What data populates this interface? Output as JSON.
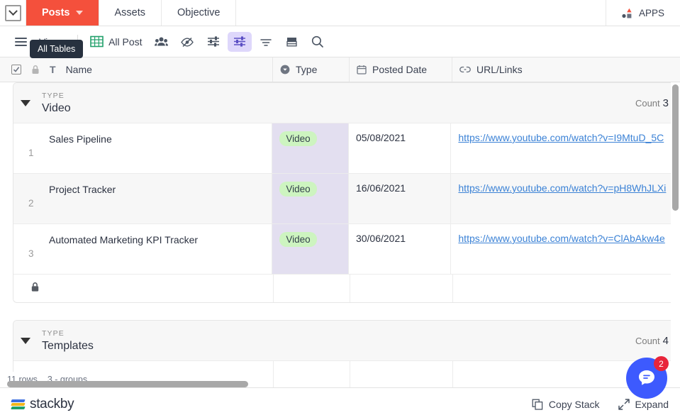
{
  "tabs": {
    "collapse_icon": "chevron-down-icon",
    "items": [
      {
        "label": "Posts",
        "active": true,
        "caret": true
      },
      {
        "label": "Assets",
        "active": false,
        "caret": false
      },
      {
        "label": "Objective",
        "active": false,
        "caret": false
      }
    ],
    "apps_label": "APPS",
    "apps_icon": "apps-icon",
    "active_color": "#f4503c"
  },
  "toolbar": {
    "menu_icon": "hamburger-icon",
    "views_label": "Views",
    "tooltip": "All Tables",
    "grid_icon": "grid-view-icon",
    "view_name": "All Post",
    "collaborators_icon": "collaborators-icon",
    "hide_fields_icon": "hide-fields-icon",
    "filter_icon": "filter-icon",
    "group_icon": "group-icon",
    "sort_icon": "sort-icon",
    "row_height_icon": "row-height-icon",
    "search_icon": "search-icon",
    "selected_accent": "#ded7fb"
  },
  "grid": {
    "columns": [
      {
        "label": "Name",
        "icon": "text-field-icon",
        "lock_icon": "lock-icon",
        "checkbox_icon": "checkbox-checked-icon"
      },
      {
        "label": "Type",
        "icon": "single-select-icon"
      },
      {
        "label": "Posted Date",
        "icon": "calendar-icon"
      },
      {
        "label": "URL/Links",
        "icon": "link-icon"
      }
    ],
    "groups": [
      {
        "field_label": "TYPE",
        "value": "Video",
        "count_label": "Count",
        "count": "3",
        "rows": [
          {
            "num": "1",
            "name": "Sales Pipeline",
            "type": "Video",
            "date": "05/08/2021",
            "url": "https://www.youtube.com/watch?v=I9MtuD_5C"
          },
          {
            "num": "2",
            "name": "Project Tracker",
            "type": "Video",
            "date": "16/06/2021",
            "url": "https://www.youtube.com/watch?v=pH8WhJLXi"
          },
          {
            "num": "3",
            "name": "Automated Marketing KPI Tracker",
            "type": "Video",
            "date": "30/06/2021",
            "url": "https://www.youtube.com/watch?v=ClAbAkw4e"
          }
        ],
        "add_row_icon": "lock-icon"
      },
      {
        "field_label": "TYPE",
        "value": "Templates",
        "count_label": "Count",
        "count": "4",
        "rows": [],
        "add_row_icon": "lock-icon"
      }
    ],
    "badge_bg": "#cdf4c0",
    "type_cell_bg": "#e3dff0",
    "link_color": "#3b82d6"
  },
  "status": {
    "rows_text": "11 rows",
    "groups_text": "3 - groups"
  },
  "footer": {
    "logo_text": "stackby",
    "copy_stack_label": "Copy Stack",
    "copy_stack_icon": "copy-icon",
    "expand_label": "Expand",
    "expand_icon": "expand-icon",
    "chat_icon": "chat-bubble-icon",
    "chat_badge": "2",
    "chat_color": "#3d5afe",
    "badge_color": "#e8253a"
  }
}
